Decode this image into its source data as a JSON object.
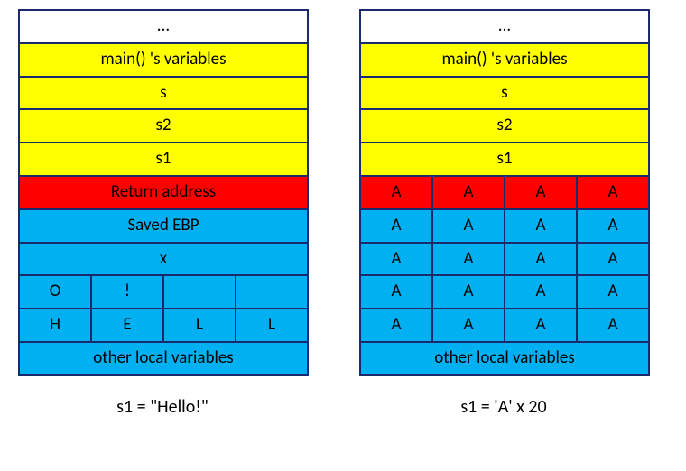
{
  "left": {
    "ell": "...",
    "main_vars": "main() 's variables",
    "s": "s",
    "s2": "s2",
    "s1": "s1",
    "ret": "Return address",
    "ebp": "Saved EBP",
    "x": "x",
    "buf_r1": [
      "O",
      "!",
      "",
      ""
    ],
    "buf_r0": [
      "H",
      "E",
      "L",
      "L"
    ],
    "other": "other local variables",
    "caption": "s1 = \"Hello!\""
  },
  "right": {
    "ell": "...",
    "main_vars": "main() 's variables",
    "s": "s",
    "s2": "s2",
    "s1": "s1",
    "ret": [
      "A",
      "A",
      "A",
      "A"
    ],
    "ebp": [
      "A",
      "A",
      "A",
      "A"
    ],
    "x": [
      "A",
      "A",
      "A",
      "A"
    ],
    "buf_r1": [
      "A",
      "A",
      "A",
      "A"
    ],
    "buf_r0": [
      "A",
      "A",
      "A",
      "A"
    ],
    "other": "other local variables",
    "caption": "s1 = 'A' x 20"
  }
}
